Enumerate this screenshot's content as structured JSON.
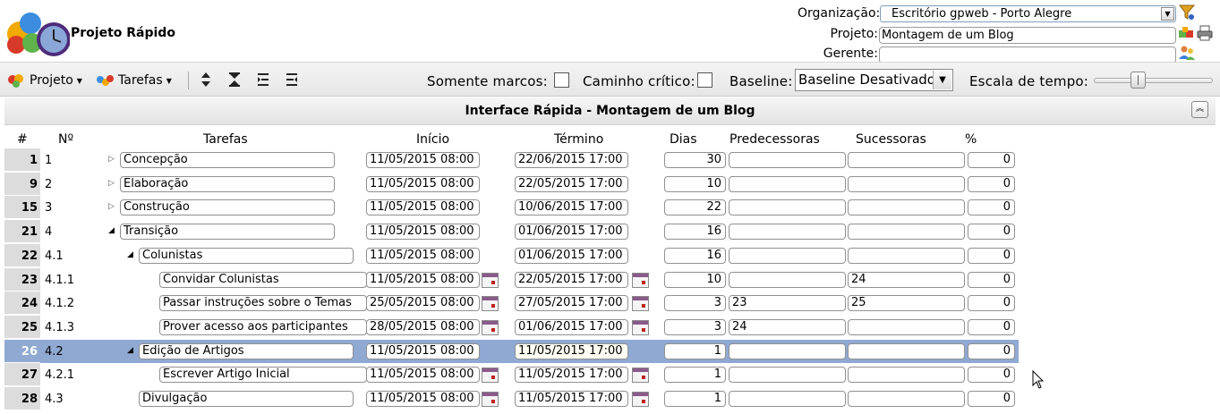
{
  "header": {
    "app_title": "Projeto Rápido",
    "organizacao_label": "Organização:",
    "organizacao_value": "Escritório gpweb - Porto Alegre",
    "projeto_label": "Projeto:",
    "projeto_value": "Montagem de um Blog",
    "gerente_label": "Gerente:",
    "gerente_value": ""
  },
  "toolbar": {
    "projeto_menu": "Projeto",
    "tarefas_menu": "Tarefas",
    "somente_marcos_label": "Somente marcos:",
    "caminho_critico_label": "Caminho crítico:",
    "baseline_label": "Baseline:",
    "baseline_value": "Baseline Desativado",
    "escala_label": "Escala de tempo:",
    "escala_fraction": 0.35
  },
  "panel": {
    "title": "Interface Rápida - Montagem de um Blog"
  },
  "columns": {
    "hash": "#",
    "numero": "Nº",
    "tarefas": "Tarefas",
    "inicio": "Início",
    "termino": "Término",
    "dias": "Dias",
    "predecessoras": "Predecessoras",
    "sucessoras": "Sucessoras",
    "percent": "%"
  },
  "rows": [
    {
      "id": "1",
      "wbs": "1",
      "level": 0,
      "expander": "collapsed",
      "name": "Concepção",
      "start": "11/05/2015 08:00",
      "end": "22/06/2015 17:00",
      "days": "30",
      "pred": "",
      "succ": "",
      "pct": "0",
      "cal": false
    },
    {
      "id": "9",
      "wbs": "2",
      "level": 0,
      "expander": "collapsed",
      "name": "Elaboração",
      "start": "11/05/2015 08:00",
      "end": "22/05/2015 17:00",
      "days": "10",
      "pred": "",
      "succ": "",
      "pct": "0",
      "cal": false
    },
    {
      "id": "15",
      "wbs": "3",
      "level": 0,
      "expander": "collapsed",
      "name": "Construção",
      "start": "11/05/2015 08:00",
      "end": "10/06/2015 17:00",
      "days": "22",
      "pred": "",
      "succ": "",
      "pct": "0",
      "cal": false
    },
    {
      "id": "21",
      "wbs": "4",
      "level": 0,
      "expander": "expanded",
      "name": "Transição",
      "start": "11/05/2015 08:00",
      "end": "01/06/2015 17:00",
      "days": "16",
      "pred": "",
      "succ": "",
      "pct": "0",
      "cal": false
    },
    {
      "id": "22",
      "wbs": "4.1",
      "level": 1,
      "expander": "expanded",
      "name": "Colunistas",
      "start": "11/05/2015 08:00",
      "end": "01/06/2015 17:00",
      "days": "16",
      "pred": "",
      "succ": "",
      "pct": "0",
      "cal": false
    },
    {
      "id": "23",
      "wbs": "4.1.1",
      "level": 2,
      "expander": "none",
      "name": "Convidar Colunistas",
      "start": "11/05/2015 08:00",
      "end": "22/05/2015 17:00",
      "days": "10",
      "pred": "",
      "succ": "24",
      "pct": "0",
      "cal": true
    },
    {
      "id": "24",
      "wbs": "4.1.2",
      "level": 2,
      "expander": "none",
      "name": "Passar instruções sobre o Temas",
      "start": "25/05/2015 08:00",
      "end": "27/05/2015 17:00",
      "days": "3",
      "pred": "23",
      "succ": "25",
      "pct": "0",
      "cal": true
    },
    {
      "id": "25",
      "wbs": "4.1.3",
      "level": 2,
      "expander": "none",
      "name": "Prover acesso aos participantes",
      "start": "28/05/2015 08:00",
      "end": "01/06/2015 17:00",
      "days": "3",
      "pred": "24",
      "succ": "",
      "pct": "0",
      "cal": true
    },
    {
      "id": "26",
      "wbs": "4.2",
      "level": 1,
      "expander": "expanded",
      "name": "Edição de Artigos",
      "start": "11/05/2015 08:00",
      "end": "11/05/2015 17:00",
      "days": "1",
      "pred": "",
      "succ": "",
      "pct": "0",
      "cal": false,
      "selected": true
    },
    {
      "id": "27",
      "wbs": "4.2.1",
      "level": 2,
      "expander": "none",
      "name": "Escrever Artigo Inicial",
      "start": "11/05/2015 08:00",
      "end": "11/05/2015 17:00",
      "days": "1",
      "pred": "",
      "succ": "",
      "pct": "0",
      "cal": true
    },
    {
      "id": "28",
      "wbs": "4.3",
      "level": 1,
      "expander": "none",
      "name": "Divulgação",
      "start": "11/05/2015 08:00",
      "end": "11/05/2015 17:00",
      "days": "1",
      "pred": "",
      "succ": "",
      "pct": "0",
      "cal": true
    }
  ]
}
